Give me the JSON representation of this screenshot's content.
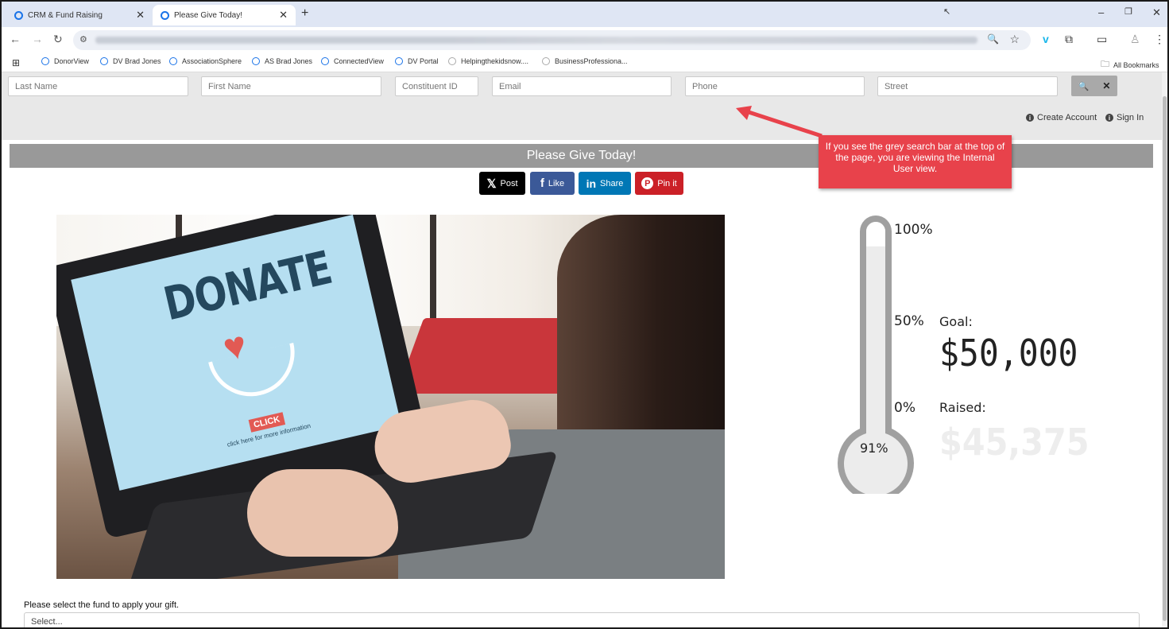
{
  "browser": {
    "tabs": [
      {
        "label": "CRM & Fund Raising"
      },
      {
        "label": "Please Give Today!"
      }
    ],
    "new_tab": "+",
    "window_controls": {
      "minimize": "–",
      "restore": "❐",
      "close": "✕"
    },
    "bookmarks": [
      {
        "label": "DonorView"
      },
      {
        "label": "DV Brad Jones"
      },
      {
        "label": "AssociationSphere"
      },
      {
        "label": "AS Brad Jones"
      },
      {
        "label": "ConnectedView"
      },
      {
        "label": "DV Portal"
      },
      {
        "label": "Helpingthekidsnow...."
      },
      {
        "label": "BusinessProfessiona..."
      }
    ],
    "all_bookmarks": "All Bookmarks"
  },
  "search": {
    "fields": {
      "last_name": "Last Name",
      "first_name": "First Name",
      "constituent_id": "Constituent ID",
      "email": "Email",
      "phone": "Phone",
      "street": "Street"
    },
    "search_icon": "🔍",
    "clear_icon": "✕"
  },
  "account": {
    "create_account": "Create Account",
    "sign_in": "Sign In"
  },
  "page": {
    "title": "Please Give Today!"
  },
  "share": {
    "x": "Post",
    "facebook": "Like",
    "linkedin": "Share",
    "pinterest": "Pin it"
  },
  "hero": {
    "headline": "DONATE",
    "click": "CLICK",
    "click_sub": "click here for more information"
  },
  "thermometer": {
    "label_100": "100%",
    "label_50": "50%",
    "label_0": "0%",
    "percent_label": "91%",
    "progress_fraction": 0.91,
    "goal_label": "Goal:",
    "goal_value": "$50,000",
    "raised_label": "Raised:",
    "raised_value": "$45,375"
  },
  "callout": {
    "text": "If you see the grey search bar at the top of the page, you are viewing the Internal User view."
  },
  "fund": {
    "label": "Please select the fund to apply your gift.",
    "select_value": "Select..."
  },
  "colors": {
    "callout": "#e8424b",
    "title_bar": "#999999",
    "thermometer": "#a0a0a0"
  }
}
